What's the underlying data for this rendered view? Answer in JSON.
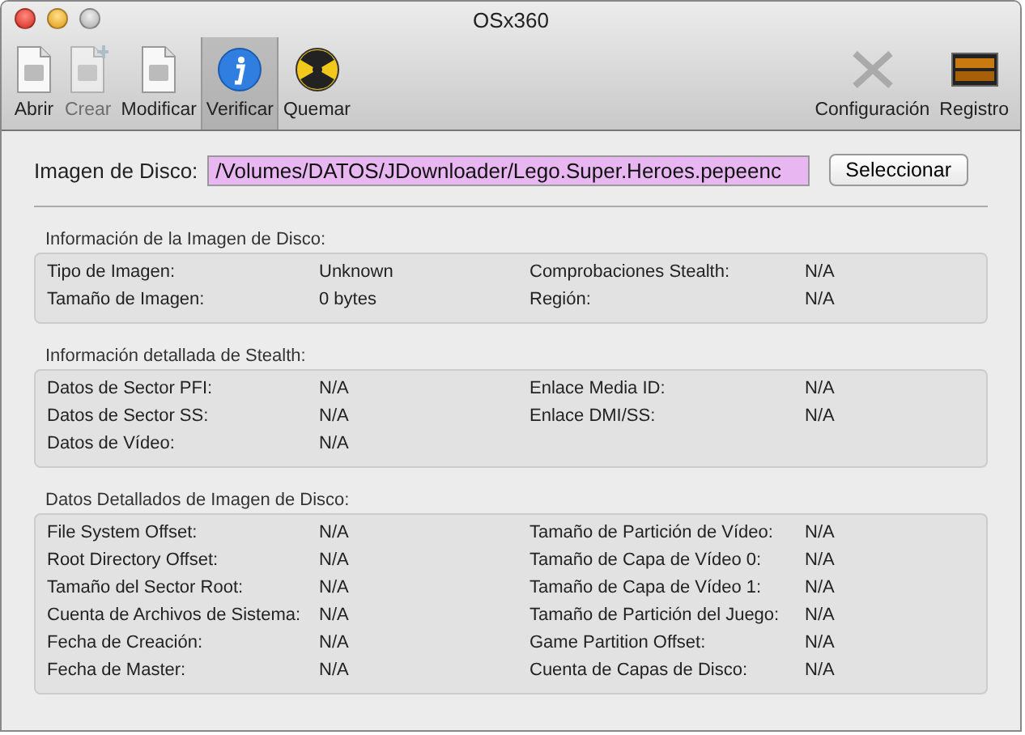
{
  "window": {
    "title": "OSx360"
  },
  "toolbar": {
    "left": [
      {
        "label": "Abrir",
        "disabled": false,
        "selected": false
      },
      {
        "label": "Crear",
        "disabled": true,
        "selected": false
      },
      {
        "label": "Modificar",
        "disabled": false,
        "selected": false
      },
      {
        "label": "Verificar",
        "disabled": false,
        "selected": true
      },
      {
        "label": "Quemar",
        "disabled": false,
        "selected": false
      }
    ],
    "right": [
      {
        "label": "Configuración",
        "disabled": false,
        "selected": false
      },
      {
        "label": "Registro",
        "disabled": false,
        "selected": false
      }
    ]
  },
  "disk_image": {
    "label": "Imagen de Disco:",
    "value": "/Volumes/DATOS/JDownloader/Lego.Super.Heroes.pepeenc",
    "button": "Seleccionar"
  },
  "sections": [
    {
      "title": "Información de la Imagen de Disco:",
      "items": [
        {
          "label": "Tipo de Imagen:",
          "value": "Unknown"
        },
        {
          "label": "Comprobaciones Stealth:",
          "value": "N/A"
        },
        {
          "label": "Tamaño de Imagen:",
          "value": "0 bytes"
        },
        {
          "label": "Región:",
          "value": "N/A"
        }
      ]
    },
    {
      "title": "Información detallada de Stealth:",
      "items": [
        {
          "label": "Datos de Sector PFI:",
          "value": "N/A"
        },
        {
          "label": "Enlace Media ID:",
          "value": "N/A"
        },
        {
          "label": "Datos de Sector SS:",
          "value": "N/A"
        },
        {
          "label": "Enlace DMI/SS:",
          "value": "N/A"
        },
        {
          "label": "Datos de Vídeo:",
          "value": "N/A"
        }
      ]
    },
    {
      "title": "Datos Detallados de Imagen de Disco:",
      "items": [
        {
          "label": "File System Offset:",
          "value": "N/A"
        },
        {
          "label": "Tamaño de Partición de Vídeo:",
          "value": "N/A"
        },
        {
          "label": "Root Directory Offset:",
          "value": "N/A"
        },
        {
          "label": "Tamaño de Capa de Vídeo 0:",
          "value": "N/A"
        },
        {
          "label": "Tamaño del Sector Root:",
          "value": "N/A"
        },
        {
          "label": "Tamaño de Capa de Vídeo 1:",
          "value": "N/A"
        },
        {
          "label": "Cuenta de Archivos de Sistema:",
          "value": "N/A"
        },
        {
          "label": "Tamaño de Partición del Juego:",
          "value": "N/A"
        },
        {
          "label": "Fecha de Creación:",
          "value": "N/A"
        },
        {
          "label": "Game Partition Offset:",
          "value": "N/A"
        },
        {
          "label": "Fecha de Master:",
          "value": "N/A"
        },
        {
          "label": "Cuenta de Capas de Disco:",
          "value": "N/A"
        }
      ]
    }
  ]
}
